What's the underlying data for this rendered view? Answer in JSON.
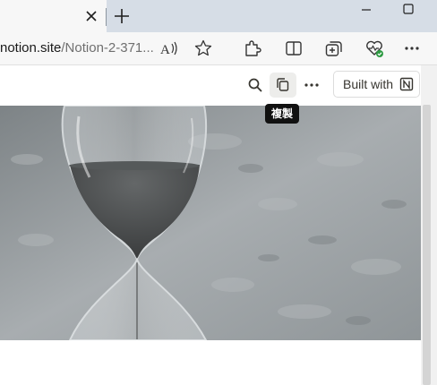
{
  "tab": {
    "close_icon": "close-icon",
    "new_tab_icon": "plus-icon"
  },
  "window": {
    "minimize_icon": "minimize-icon",
    "maximize_icon": "maximize-icon"
  },
  "address_bar": {
    "host": "notion.site",
    "path": "/Notion-2-371..."
  },
  "toolbar": {
    "icons": [
      "read-aloud-icon",
      "favorite-star-icon",
      "extensions-icon",
      "split-screen-icon",
      "collections-icon",
      "browser-essentials-icon",
      "more-icon"
    ]
  },
  "notion": {
    "search_icon": "search-icon",
    "duplicate_icon": "duplicate-icon",
    "more_icon": "more-icon",
    "built_with_label": "Built with",
    "tooltip_label": "複製"
  },
  "colors": {
    "tabstrip": "#d6dde6",
    "toolbar": "#f7f7f7",
    "tooltip": "#111111",
    "health_badge": "#2e9b43"
  }
}
